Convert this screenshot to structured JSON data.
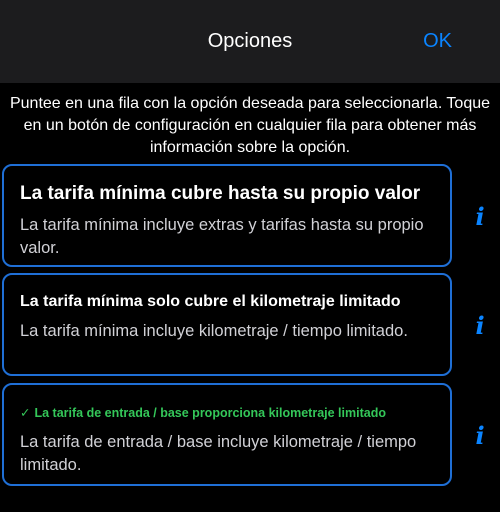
{
  "navbar": {
    "title": "Opciones",
    "ok_label": "OK"
  },
  "instructions": "Puntee en una fila con la opción deseada para seleccionarla. Toque en un botón de configuración en cualquier fila para obtener más información sobre la opción.",
  "options": [
    {
      "title": "La tarifa mínima cubre hasta su propio valor",
      "description": "La tarifa mínima incluye extras y tarifas hasta su propio valor.",
      "selected": false,
      "info_icon": "i"
    },
    {
      "title": "La tarifa mínima solo cubre el kilometraje limitado",
      "description": "La tarifa mínima incluye kilometraje / tiempo limitado.",
      "selected": false,
      "info_icon": "i"
    },
    {
      "title": "La tarifa de entrada / base proporciona kilometraje limitado",
      "description": "La tarifa de entrada / base incluye kilometraje / tiempo limitado.",
      "selected": true,
      "check_mark": "✓",
      "info_icon": "i"
    }
  ],
  "colors": {
    "accent": "#0a84ff",
    "selected": "#34c759",
    "border": "#1f6fd6"
  }
}
